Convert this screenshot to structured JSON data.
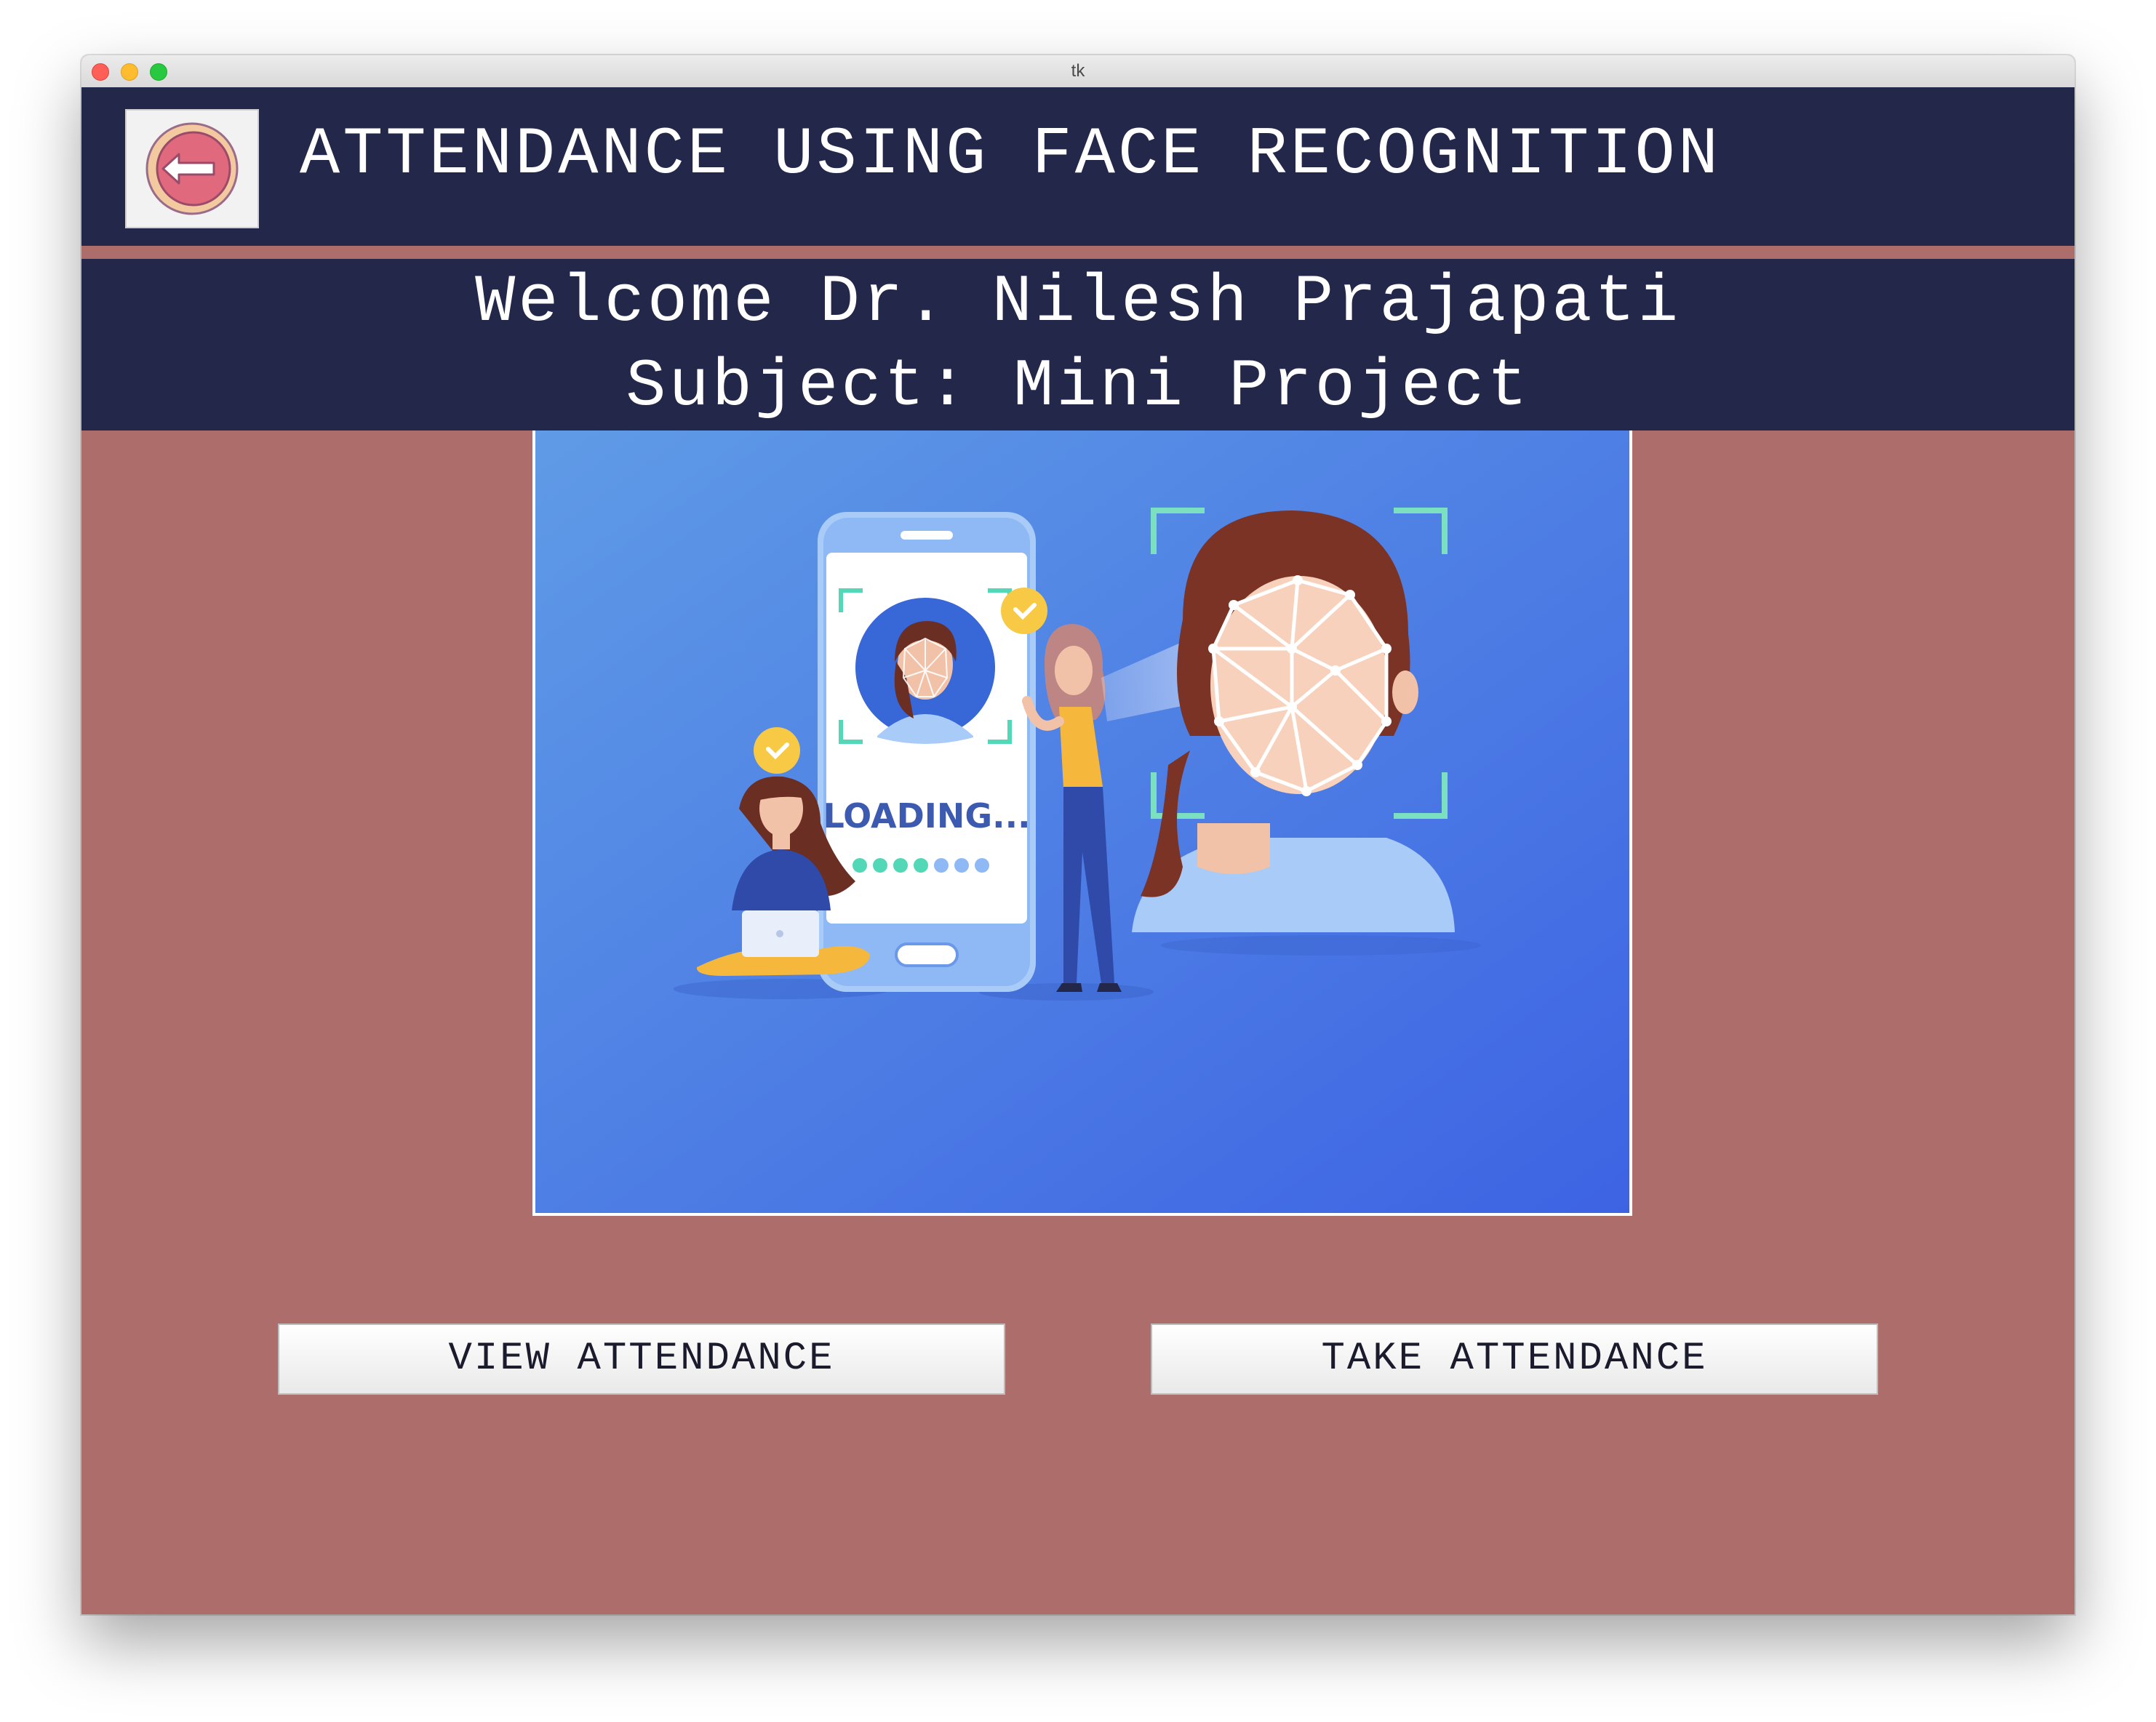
{
  "window": {
    "title": "tk"
  },
  "header": {
    "title": "ATTENDANCE USING FACE RECOGNITION",
    "logout_icon": "logout-arrow-icon"
  },
  "welcome": {
    "greeting": "Welcome Dr. Nilesh Prajapati",
    "subject": "Subject: Mini Project"
  },
  "illustration": {
    "phone_text": "LOADING..."
  },
  "actions": {
    "view_label": "VIEW ATTENDANCE",
    "take_label": "TAKE ATTENDANCE"
  },
  "colors": {
    "header_bg": "#23274a",
    "body_bg": "#ad6d6b",
    "accent_pink": "#e0697d",
    "hero_blue": "#4a7fe0"
  }
}
